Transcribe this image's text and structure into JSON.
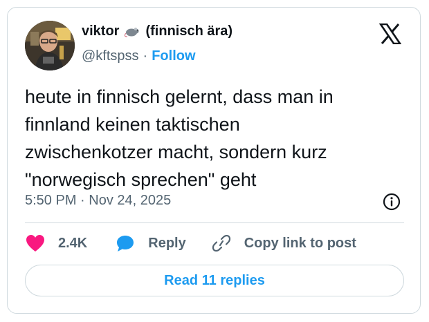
{
  "author": {
    "display_name": "viktor",
    "name_suffix": "(finnisch ära)",
    "handle": "@kftspss",
    "separator": "·",
    "follow_label": "Follow",
    "avatar_icon": "avatar-photo",
    "emoji_icon": "rat-emoji-icon"
  },
  "post": {
    "text": "heute in finnisch gelernt, dass man in\nfinnland keinen taktischen\nzwischenkotzer macht, sondern kurz\n\"norwegisch sprechen\" geht",
    "timestamp": "5:50 PM · Nov 24, 2025"
  },
  "actions": {
    "like_count": "2.4K",
    "reply_label": "Reply",
    "copy_label": "Copy link to post",
    "read_replies_label": "Read 11 replies"
  },
  "colors": {
    "accent": "#1d9bf0",
    "like": "#f91880",
    "muted": "#536471",
    "border": "#cfd9de"
  }
}
